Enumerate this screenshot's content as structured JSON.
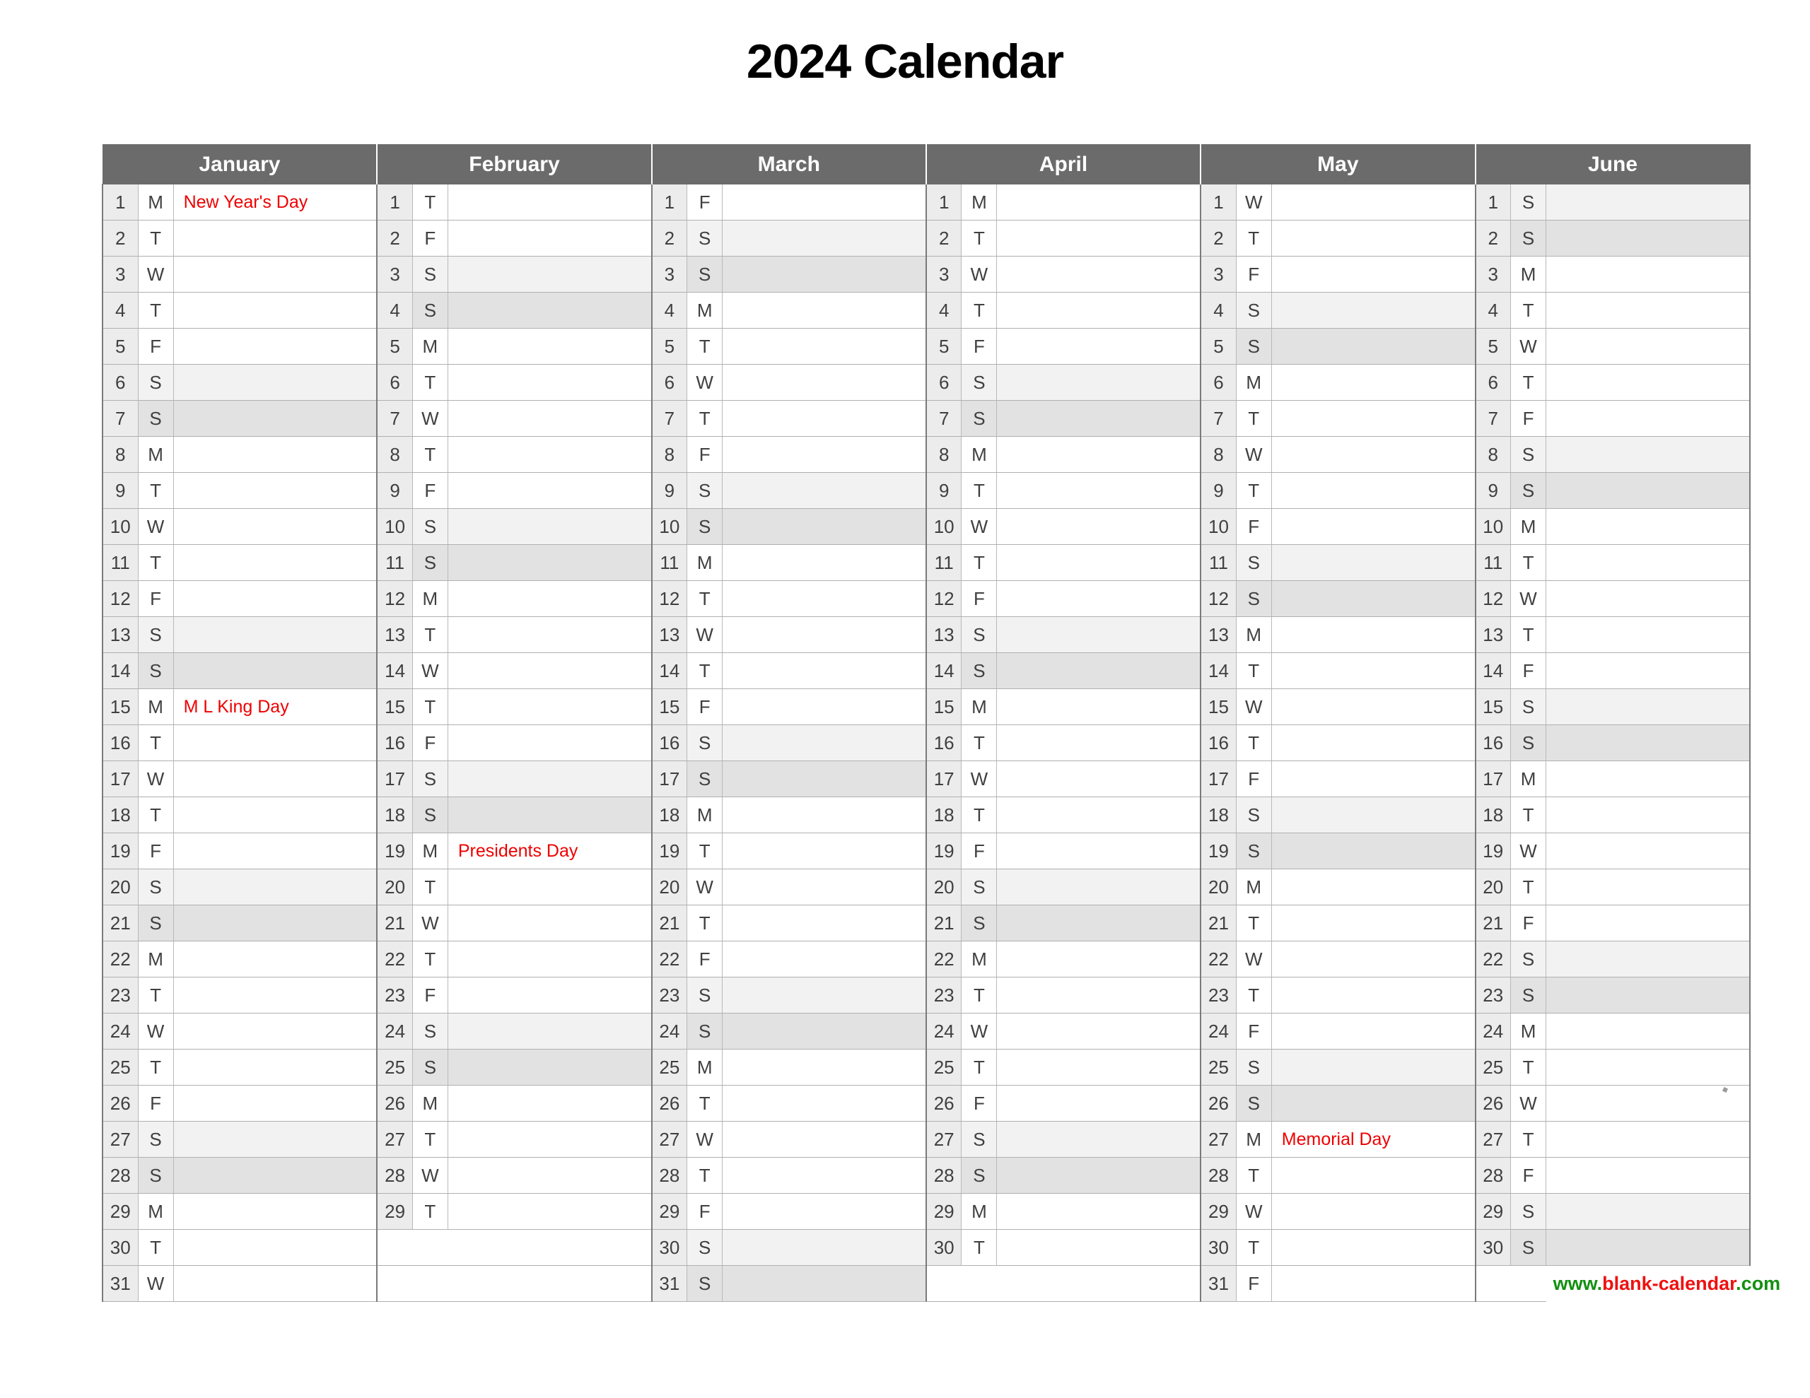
{
  "document": {
    "title": "2024 Calendar",
    "year": "2024"
  },
  "footer": {
    "site_prefix": "www.",
    "site_name": "blank-calendar",
    "site_suffix": ".com",
    "full": "www.blank-calendar.com",
    "color_green": "#139010",
    "color_red": "#ee1111"
  },
  "colors": {
    "header_bg": "#6b6b6b",
    "header_text": "#ffffff",
    "holiday_text": "#ee0000",
    "day_number_bg": "#ececec",
    "saturday_bg": "#f2f2f2",
    "sunday_bg": "#e2e2e2",
    "grid_line": "#b0b0b0",
    "body_text": "#404040"
  },
  "months": [
    {
      "name": "January",
      "days": 31,
      "day_letters": [
        "M",
        "T",
        "W",
        "T",
        "F",
        "S",
        "S",
        "M",
        "T",
        "W",
        "T",
        "F",
        "S",
        "S",
        "M",
        "T",
        "W",
        "T",
        "F",
        "S",
        "S",
        "M",
        "T",
        "W",
        "T",
        "F",
        "S",
        "S",
        "M",
        "T",
        "W"
      ],
      "notes": {
        "1": "New Year's Day",
        "15": "M L King Day"
      }
    },
    {
      "name": "February",
      "days": 29,
      "day_letters": [
        "T",
        "F",
        "S",
        "S",
        "M",
        "T",
        "W",
        "T",
        "F",
        "S",
        "S",
        "M",
        "T",
        "W",
        "T",
        "F",
        "S",
        "S",
        "M",
        "T",
        "W",
        "T",
        "F",
        "S",
        "S",
        "M",
        "T",
        "W",
        "T"
      ],
      "notes": {
        "19": "Presidents Day"
      }
    },
    {
      "name": "March",
      "days": 31,
      "day_letters": [
        "F",
        "S",
        "S",
        "M",
        "T",
        "W",
        "T",
        "F",
        "S",
        "S",
        "M",
        "T",
        "W",
        "T",
        "F",
        "S",
        "S",
        "M",
        "T",
        "W",
        "T",
        "F",
        "S",
        "S",
        "M",
        "T",
        "W",
        "T",
        "F",
        "S",
        "S"
      ],
      "notes": {}
    },
    {
      "name": "April",
      "days": 30,
      "day_letters": [
        "M",
        "T",
        "W",
        "T",
        "F",
        "S",
        "S",
        "M",
        "T",
        "W",
        "T",
        "F",
        "S",
        "S",
        "M",
        "T",
        "W",
        "T",
        "F",
        "S",
        "S",
        "M",
        "T",
        "W",
        "T",
        "F",
        "S",
        "S",
        "M",
        "T"
      ],
      "notes": {}
    },
    {
      "name": "May",
      "days": 31,
      "day_letters": [
        "W",
        "T",
        "F",
        "S",
        "S",
        "M",
        "T",
        "W",
        "T",
        "F",
        "S",
        "S",
        "M",
        "T",
        "W",
        "T",
        "F",
        "S",
        "S",
        "M",
        "T",
        "W",
        "T",
        "F",
        "S",
        "S",
        "M",
        "T",
        "W",
        "T",
        "F"
      ],
      "notes": {
        "27": "Memorial Day"
      }
    },
    {
      "name": "June",
      "days": 30,
      "day_letters": [
        "S",
        "S",
        "M",
        "T",
        "W",
        "T",
        "F",
        "S",
        "S",
        "M",
        "T",
        "W",
        "T",
        "F",
        "S",
        "S",
        "M",
        "T",
        "W",
        "T",
        "F",
        "S",
        "S",
        "M",
        "T",
        "W",
        "T",
        "F",
        "S",
        "S"
      ],
      "notes": {}
    }
  ]
}
